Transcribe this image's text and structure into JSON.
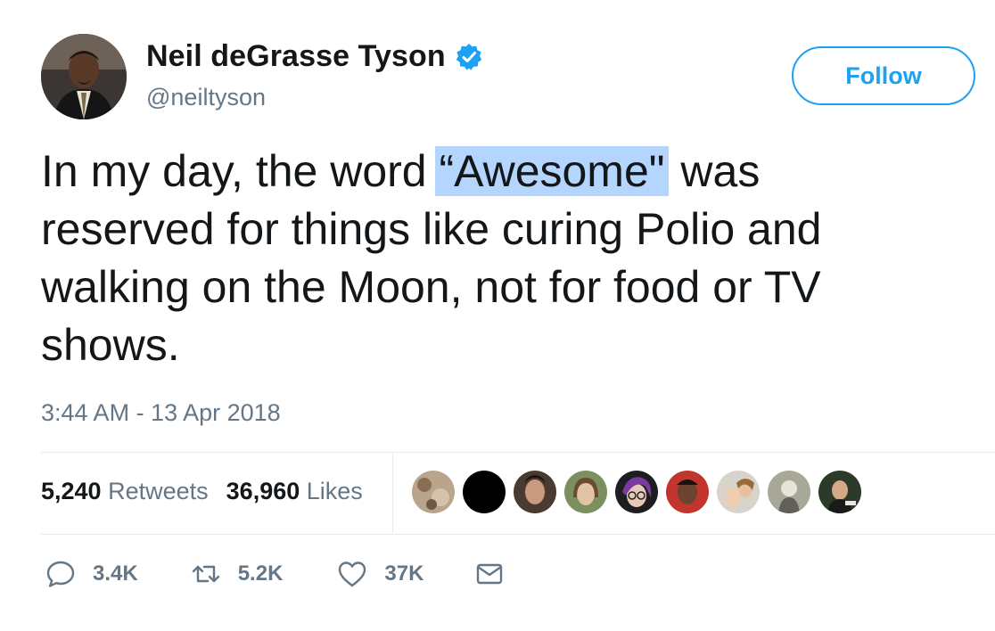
{
  "user": {
    "display_name": "Neil deGrasse Tyson",
    "handle": "@neiltyson",
    "verified": true
  },
  "follow_label": "Follow",
  "tweet": {
    "line1_before": "In my day, the word ",
    "highlighted": "“Awesome\"",
    "line1_after": " was",
    "line2": "reserved for things like curing Polio and",
    "line3": "walking on the Moon, not for food or TV",
    "line4": "shows."
  },
  "timestamp": "3:44 AM - 13 Apr 2018",
  "stats": {
    "retweets_count": "5,240",
    "retweets_label": "Retweets",
    "likes_count": "36,960",
    "likes_label": "Likes"
  },
  "actions": {
    "replies": "3.4K",
    "retweets": "5.2K",
    "likes": "37K"
  },
  "colors": {
    "accent": "#1da1f2",
    "muted": "#657786",
    "highlight": "#b4d5fe"
  }
}
